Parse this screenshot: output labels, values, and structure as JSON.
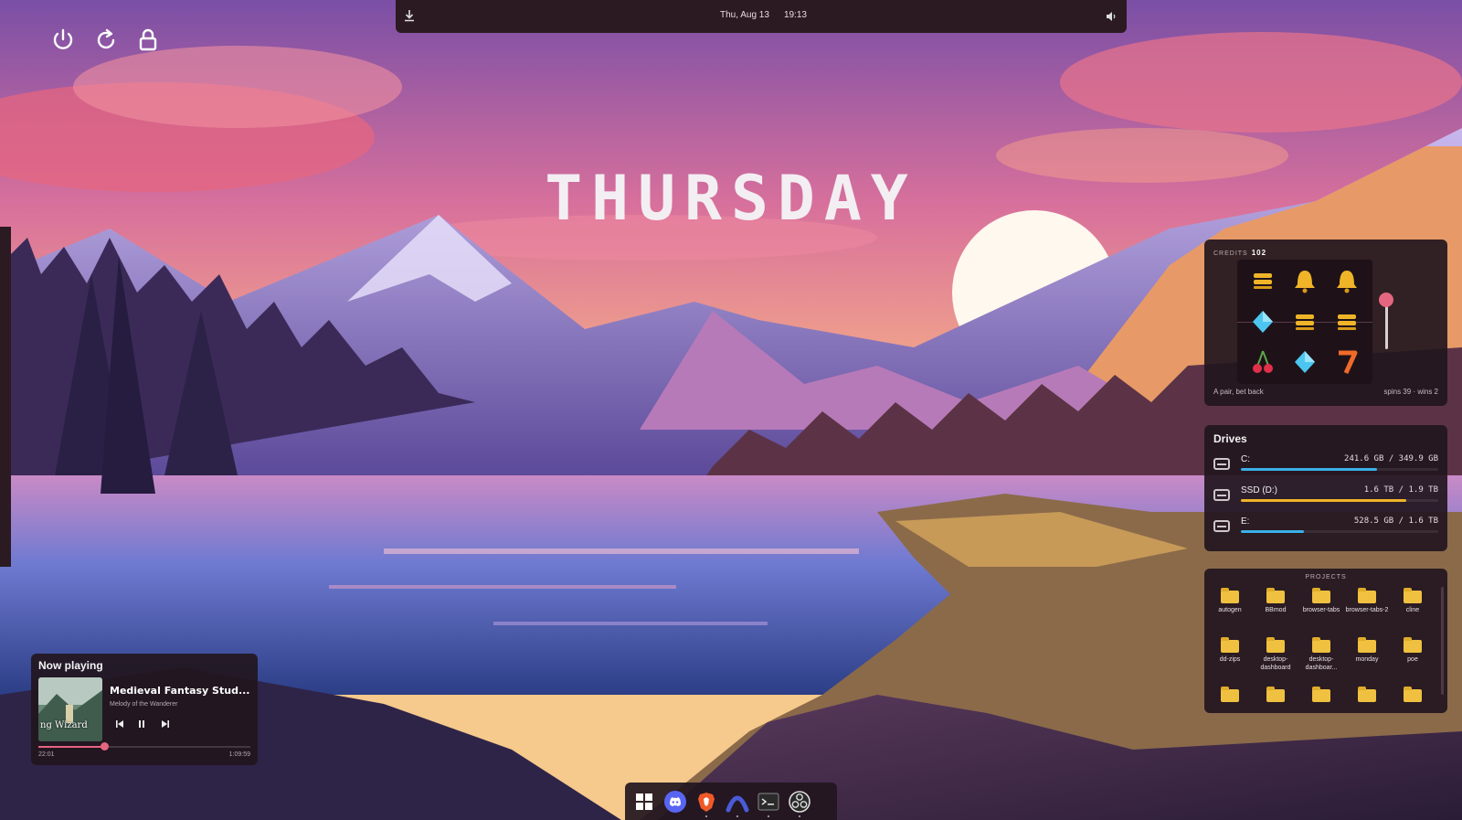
{
  "topbar": {
    "app_icon": "download-icon",
    "date": "Thu, Aug 13",
    "time": "19:13",
    "volume_icon": "speaker-icon"
  },
  "power_controls": [
    "power-icon",
    "restart-icon",
    "lock-icon"
  ],
  "day_name": "THURSDAY",
  "slot_machine": {
    "credits_label": "CREDITS",
    "credits_value": "102",
    "reels": [
      [
        "bar",
        "bell",
        "bell"
      ],
      [
        "diamond",
        "bar",
        "bar"
      ],
      [
        "cherry",
        "diamond",
        "seven"
      ]
    ],
    "message": "A pair, bet back",
    "stats": "spins 39 · wins 2"
  },
  "drives": {
    "title": "Drives",
    "items": [
      {
        "name": "C:",
        "size": "241.6 GB / 349.9 GB",
        "fraction": 0.69,
        "color": "#3ab0e8"
      },
      {
        "name": "SSD (D:)",
        "size": "1.6 TB / 1.9 TB",
        "fraction": 0.84,
        "color": "#f0b429"
      },
      {
        "name": "E:",
        "size": "528.5 GB / 1.6 TB",
        "fraction": 0.32,
        "color": "#3ab0e8"
      }
    ]
  },
  "projects": {
    "title": "PROJECTS",
    "folders": [
      "autogen",
      "BBmod",
      "browser-tabs",
      "browser-tabs-2",
      "cline",
      "dd-zips",
      "desktop-dashboard",
      "desktop-dashboar...",
      "monday",
      "poe"
    ]
  },
  "now_playing": {
    "header": "Now playing",
    "track": "Medieval Fantasy Stud...",
    "album": "Melody of the Wanderer",
    "art_text": "ng Wizard",
    "elapsed": "22:01",
    "duration": "1:09:59",
    "progress": 0.31
  },
  "taskbar": [
    "windows-start-icon",
    "discord-icon",
    "brave-browser-icon",
    "arc-app-icon",
    "terminal-icon",
    "obs-icon"
  ],
  "colors": {
    "accent": "#e56680",
    "panel": "#22161e"
  }
}
